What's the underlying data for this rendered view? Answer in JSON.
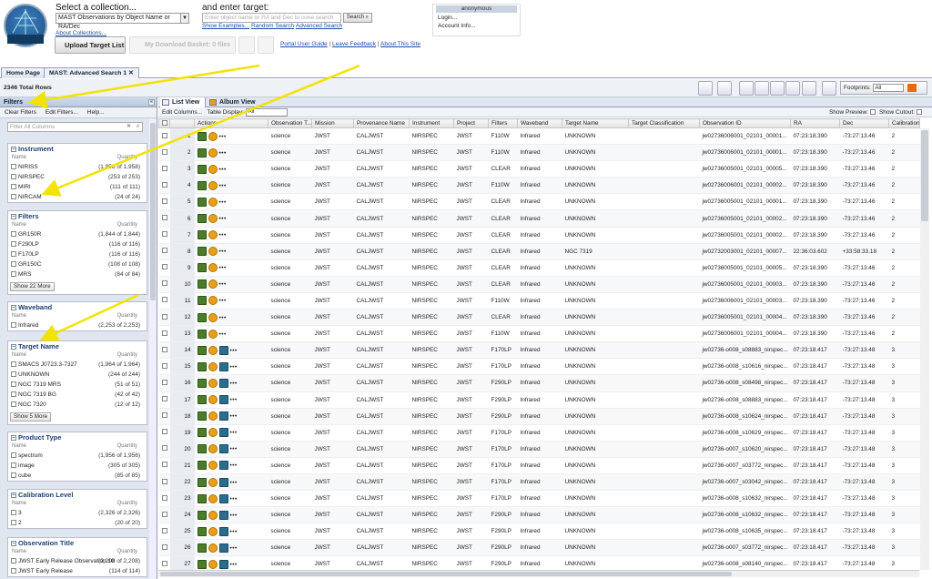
{
  "header": {
    "collection_prompt": "Select a collection...",
    "collection_value": "MAST Observations by Object Name or RA/Dec",
    "about_collections": "About Collections...",
    "target_prompt": "and enter target:",
    "target_placeholder": "Enter object name or RA and Dec to cone search",
    "search_button": "Search",
    "show_examples": "Show Examples...",
    "random_search": "Random Search",
    "advanced_search": "Advanced Search",
    "upload_target_list": "Upload Target List",
    "my_download_basket": "My Download Basket: 0 files",
    "portal_user_guide": "Portal User Guide",
    "leave_feedback": "Leave Feedback",
    "about_this_site": "About This Site",
    "separator": "|"
  },
  "account": {
    "user": "anonymous",
    "login": "Login...",
    "account_info": "Account Info..."
  },
  "tabs": [
    {
      "label": "Home Page"
    },
    {
      "label": "MAST: Advanced Search 1"
    }
  ],
  "results": {
    "total_rows": "2346 Total Rows",
    "footprints_label": "Footprints:",
    "footprints_value": "All"
  },
  "filters_panel": {
    "title": "Filters",
    "clear_filters": "Clear Filters",
    "edit_filters": "Edit Filters...",
    "help": "Help...",
    "filter_all_placeholder": "Filter All Columns",
    "col_name": "Name",
    "col_quantity": "Quantity",
    "groups": [
      {
        "title": "Instrument",
        "items": [
          {
            "name": "NIRISS",
            "count": "(1,958 of 1,958)"
          },
          {
            "name": "NIRSPEC",
            "count": "(253 of 253)"
          },
          {
            "name": "MIRI",
            "count": "(111 of 111)"
          },
          {
            "name": "NIRCAM",
            "count": "(24 of 24)"
          }
        ]
      },
      {
        "title": "Filters",
        "items": [
          {
            "name": "GR150R",
            "count": "(1,844 of 1,844)"
          },
          {
            "name": "F290LP",
            "count": "(116 of 116)"
          },
          {
            "name": "F170LP",
            "count": "(116 of 116)"
          },
          {
            "name": "GR150C",
            "count": "(108 of 108)"
          },
          {
            "name": "MRS",
            "count": "(84 of 84)"
          }
        ],
        "more": "Show 22 More"
      },
      {
        "title": "Waveband",
        "items": [
          {
            "name": "Infrared",
            "count": "(2,253 of 2,253)"
          }
        ]
      },
      {
        "title": "Target Name",
        "items": [
          {
            "name": "SMACS J0723.3-7327",
            "count": "(1,964 of 1,964)"
          },
          {
            "name": "UNKNOWN",
            "count": "(244 of 244)"
          },
          {
            "name": "NGC 7319 MRS",
            "count": "(51 of 51)"
          },
          {
            "name": "NGC 7319 BG",
            "count": "(42 of 42)"
          },
          {
            "name": "NGC 7320",
            "count": "(12 of 12)"
          }
        ],
        "more": "Show 5 More"
      },
      {
        "title": "Product Type",
        "items": [
          {
            "name": "spectrum",
            "count": "(1,956 of 1,956)"
          },
          {
            "name": "image",
            "count": "(305 of 305)"
          },
          {
            "name": "cube",
            "count": "(85 of 85)"
          }
        ]
      },
      {
        "title": "Calibration Level",
        "items": [
          {
            "name": "3",
            "count": "(2,326 of 2,326)"
          },
          {
            "name": "2",
            "count": "(20 of 20)"
          }
        ]
      },
      {
        "title": "Observation Title",
        "items": [
          {
            "name": "JWST Early Release Observation 10",
            "count": "(2,208 of 2,208)"
          },
          {
            "name": "JWST Early Release",
            "count": "(114 of 114)"
          }
        ]
      }
    ]
  },
  "view": {
    "list_view": "List View",
    "album_view": "Album View",
    "edit_columns": "Edit Columns...",
    "table_display": "Table Display:",
    "table_display_value": "All",
    "show_preview": "Show Preview:",
    "show_cutout": "Show Cutout:"
  },
  "table": {
    "columns": [
      "",
      "",
      "Actions",
      "Observation T...",
      "Mission",
      "Provenance Name",
      "Instrument",
      "Project",
      "Filters",
      "Waveband",
      "Target Name",
      "Target Classification",
      "Observation ID",
      "RA",
      "Dec",
      "Calibration L"
    ],
    "rows": [
      [
        "1",
        "science",
        "JWST",
        "CALJWST",
        "NIRSPEC",
        "JWST",
        "F110W",
        "Infrared",
        "UNKNOWN",
        "",
        "jw02736006001_02101_00001...",
        "07:23:18.390",
        "-73:27:13.46",
        "2"
      ],
      [
        "2",
        "science",
        "JWST",
        "CALJWST",
        "NIRSPEC",
        "JWST",
        "F110W",
        "Infrared",
        "UNKNOWN",
        "",
        "jw02736006001_02101_00001...",
        "07:23:18.390",
        "-73:27:13.46",
        "2"
      ],
      [
        "3",
        "science",
        "JWST",
        "CALJWST",
        "NIRSPEC",
        "JWST",
        "CLEAR",
        "Infrared",
        "UNKNOWN",
        "",
        "jw02736005001_02101_00005...",
        "07:23:18.390",
        "-73:27:13.46",
        "2"
      ],
      [
        "4",
        "science",
        "JWST",
        "CALJWST",
        "NIRSPEC",
        "JWST",
        "F110W",
        "Infrared",
        "UNKNOWN",
        "",
        "jw02736006001_02101_00002...",
        "07:23:18.390",
        "-73:27:13.46",
        "2"
      ],
      [
        "5",
        "science",
        "JWST",
        "CALJWST",
        "NIRSPEC",
        "JWST",
        "CLEAR",
        "Infrared",
        "UNKNOWN",
        "",
        "jw02736005001_02101_00001...",
        "07:23:18.390",
        "-73:27:13.46",
        "2"
      ],
      [
        "6",
        "science",
        "JWST",
        "CALJWST",
        "NIRSPEC",
        "JWST",
        "CLEAR",
        "Infrared",
        "UNKNOWN",
        "",
        "jw02736005001_02101_00002...",
        "07:23:18.390",
        "-73:27:13.46",
        "2"
      ],
      [
        "7",
        "science",
        "JWST",
        "CALJWST",
        "NIRSPEC",
        "JWST",
        "CLEAR",
        "Infrared",
        "UNKNOWN",
        "",
        "jw02736005001_02101_00002...",
        "07:23:18.390",
        "-73:27:13.46",
        "2"
      ],
      [
        "8",
        "science",
        "JWST",
        "CALJWST",
        "NIRSPEC",
        "JWST",
        "CLEAR",
        "Infrared",
        "NGC 7319",
        "",
        "jw02732003001_02101_00007...",
        "22:36:03.602",
        "+33:58:33.18",
        "2"
      ],
      [
        "9",
        "science",
        "JWST",
        "CALJWST",
        "NIRSPEC",
        "JWST",
        "CLEAR",
        "Infrared",
        "UNKNOWN",
        "",
        "jw02736005001_02101_00005...",
        "07:23:18.390",
        "-73:27:13.46",
        "2"
      ],
      [
        "10",
        "science",
        "JWST",
        "CALJWST",
        "NIRSPEC",
        "JWST",
        "CLEAR",
        "Infrared",
        "UNKNOWN",
        "",
        "jw02736005001_02101_00003...",
        "07:23:18.390",
        "-73:27:13.46",
        "2"
      ],
      [
        "11",
        "science",
        "JWST",
        "CALJWST",
        "NIRSPEC",
        "JWST",
        "F110W",
        "Infrared",
        "UNKNOWN",
        "",
        "jw02736006001_02101_00003...",
        "07:23:18.390",
        "-73:27:13.46",
        "2"
      ],
      [
        "12",
        "science",
        "JWST",
        "CALJWST",
        "NIRSPEC",
        "JWST",
        "CLEAR",
        "Infrared",
        "UNKNOWN",
        "",
        "jw02736005001_02101_00004...",
        "07:23:18.390",
        "-73:27:13.46",
        "2"
      ],
      [
        "13",
        "science",
        "JWST",
        "CALJWST",
        "NIRSPEC",
        "JWST",
        "F110W",
        "Infrared",
        "UNKNOWN",
        "",
        "jw02736006001_02101_00004...",
        "07:23:18.390",
        "-73:27:13.46",
        "2"
      ],
      [
        "14",
        "science",
        "JWST",
        "CALJWST",
        "NIRSPEC",
        "JWST",
        "F170LP",
        "Infrared",
        "UNKNOWN",
        "",
        "jw02736-o008_s08883_nirspec...",
        "07:23:18.417",
        "-73:27:13.48",
        "3"
      ],
      [
        "15",
        "science",
        "JWST",
        "CALJWST",
        "NIRSPEC",
        "JWST",
        "F170LP",
        "Infrared",
        "UNKNOWN",
        "",
        "jw02736-o008_s10616_nirspec...",
        "07:23:18.417",
        "-73:27:13.48",
        "3"
      ],
      [
        "16",
        "science",
        "JWST",
        "CALJWST",
        "NIRSPEC",
        "JWST",
        "F290LP",
        "Infrared",
        "UNKNOWN",
        "",
        "jw02736-o008_s08498_nirspec...",
        "07:23:18.417",
        "-73:27:13.48",
        "3"
      ],
      [
        "17",
        "science",
        "JWST",
        "CALJWST",
        "NIRSPEC",
        "JWST",
        "F290LP",
        "Infrared",
        "UNKNOWN",
        "",
        "jw02736-o008_s08883_nirspec...",
        "07:23:18.417",
        "-73:27:13.48",
        "3"
      ],
      [
        "18",
        "science",
        "JWST",
        "CALJWST",
        "NIRSPEC",
        "JWST",
        "F290LP",
        "Infrared",
        "UNKNOWN",
        "",
        "jw02736-o008_s10624_nirspec...",
        "07:23:18.417",
        "-73:27:13.48",
        "3"
      ],
      [
        "19",
        "science",
        "JWST",
        "CALJWST",
        "NIRSPEC",
        "JWST",
        "F170LP",
        "Infrared",
        "UNKNOWN",
        "",
        "jw02736-o008_s10629_nirspec...",
        "07:23:18.417",
        "-73:27:13.48",
        "3"
      ],
      [
        "20",
        "science",
        "JWST",
        "CALJWST",
        "NIRSPEC",
        "JWST",
        "F170LP",
        "Infrared",
        "UNKNOWN",
        "",
        "jw02736-o007_s10620_nirspec...",
        "07:23:18.417",
        "-73:27:13.48",
        "3"
      ],
      [
        "21",
        "science",
        "JWST",
        "CALJWST",
        "NIRSPEC",
        "JWST",
        "F170LP",
        "Infrared",
        "UNKNOWN",
        "",
        "jw02736-o007_s03772_nirspec...",
        "07:23:18.417",
        "-73:27:13.48",
        "3"
      ],
      [
        "22",
        "science",
        "JWST",
        "CALJWST",
        "NIRSPEC",
        "JWST",
        "F170LP",
        "Infrared",
        "UNKNOWN",
        "",
        "jw02736-o007_s03042_nirspec...",
        "07:23:18.417",
        "-73:27:13.48",
        "3"
      ],
      [
        "23",
        "science",
        "JWST",
        "CALJWST",
        "NIRSPEC",
        "JWST",
        "F170LP",
        "Infrared",
        "UNKNOWN",
        "",
        "jw02736-o008_s10632_nirspec...",
        "07:23:18.417",
        "-73:27:13.48",
        "3"
      ],
      [
        "24",
        "science",
        "JWST",
        "CALJWST",
        "NIRSPEC",
        "JWST",
        "F290LP",
        "Infrared",
        "UNKNOWN",
        "",
        "jw02736-o008_s10632_nirspec...",
        "07:23:18.417",
        "-73:27:13.48",
        "3"
      ],
      [
        "25",
        "science",
        "JWST",
        "CALJWST",
        "NIRSPEC",
        "JWST",
        "F290LP",
        "Infrared",
        "UNKNOWN",
        "",
        "jw02736-o008_s10635_nirspec...",
        "07:23:18.417",
        "-73:27:13.48",
        "3"
      ],
      [
        "26",
        "science",
        "JWST",
        "CALJWST",
        "NIRSPEC",
        "JWST",
        "F290LP",
        "Infrared",
        "UNKNOWN",
        "",
        "jw02736-o007_s03772_nirspec...",
        "07:23:18.417",
        "-73:27:13.48",
        "3"
      ],
      [
        "27",
        "science",
        "JWST",
        "CALJWST",
        "NIRSPEC",
        "JWST",
        "F290LP",
        "Infrared",
        "UNKNOWN",
        "",
        "jw02736-o008_s08140_nirspec...",
        "07:23:18.417",
        "-73:27:13.48",
        "3"
      ]
    ]
  },
  "colors": {
    "accent_orange": "#ea6a12",
    "annotation_arrow": "#f2e300",
    "panel_blue": "#dfe6ef"
  }
}
